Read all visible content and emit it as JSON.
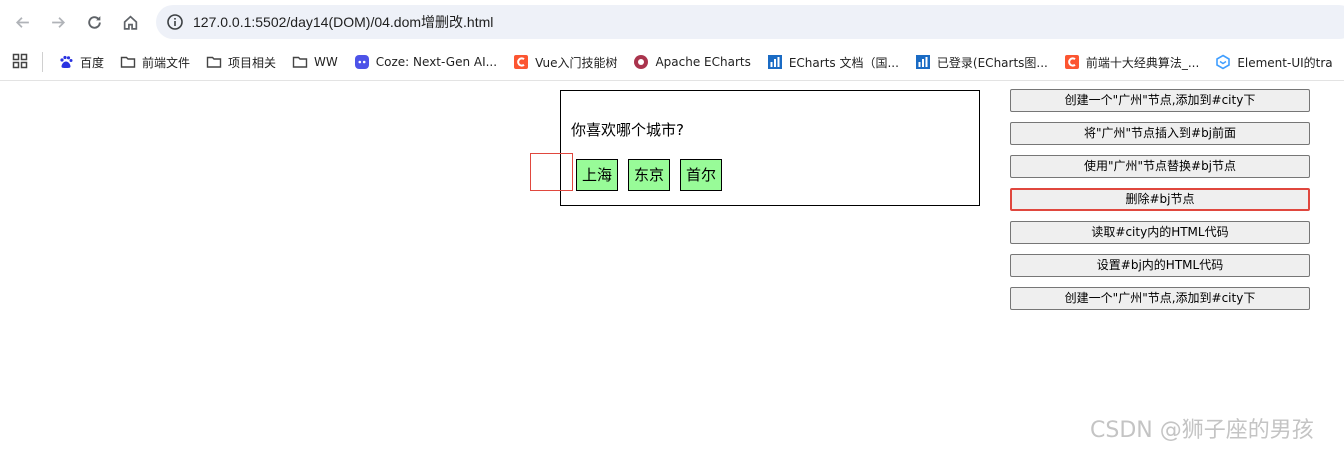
{
  "browser": {
    "url": "127.0.0.1:5502/day14(DOM)/04.dom增删改.html"
  },
  "bookmarks": [
    {
      "label": "百度",
      "icon": "baidu-paw-icon",
      "color": "#2932e1"
    },
    {
      "label": "前端文件",
      "icon": "folder-icon",
      "color": "#444444"
    },
    {
      "label": "项目相关",
      "icon": "folder-icon",
      "color": "#444444"
    },
    {
      "label": "WW",
      "icon": "folder-icon",
      "color": "#444444"
    },
    {
      "label": "Coze: Next-Gen AI...",
      "icon": "coze-icon",
      "color": "#4d53e8"
    },
    {
      "label": "Vue入门技能树",
      "icon": "csdn-icon",
      "color": "#fc5531"
    },
    {
      "label": "Apache ECharts",
      "icon": "echarts-icon",
      "color": "#aa344d"
    },
    {
      "label": "ECharts 文档（国...",
      "icon": "chart-icon",
      "color": "#1a6bc4"
    },
    {
      "label": "已登录(ECharts图...",
      "icon": "chart-icon",
      "color": "#1a6bc4"
    },
    {
      "label": "前端十大经典算法_...",
      "icon": "csdn-icon",
      "color": "#fc5531"
    },
    {
      "label": "Element-UI的tra",
      "icon": "element-icon",
      "color": "#409eff"
    }
  ],
  "content": {
    "question": "你喜欢哪个城市?",
    "cities": [
      "上海",
      "东京",
      "首尔"
    ]
  },
  "buttons": [
    {
      "label": "创建一个\"广州\"节点,添加到#city下",
      "selected": false
    },
    {
      "label": "将\"广州\"节点插入到#bj前面",
      "selected": false
    },
    {
      "label": "使用\"广州\"节点替换#bj节点",
      "selected": false
    },
    {
      "label": "删除#bj节点",
      "selected": true
    },
    {
      "label": "读取#city内的HTML代码",
      "selected": false
    },
    {
      "label": "设置#bj内的HTML代码",
      "selected": false
    },
    {
      "label": "创建一个\"广州\"节点,添加到#city下",
      "selected": false
    }
  ],
  "watermark": "CSDN @狮子座的男孩",
  "colors": {
    "city_bg": "#98fb98",
    "highlight": "#e0473e"
  }
}
